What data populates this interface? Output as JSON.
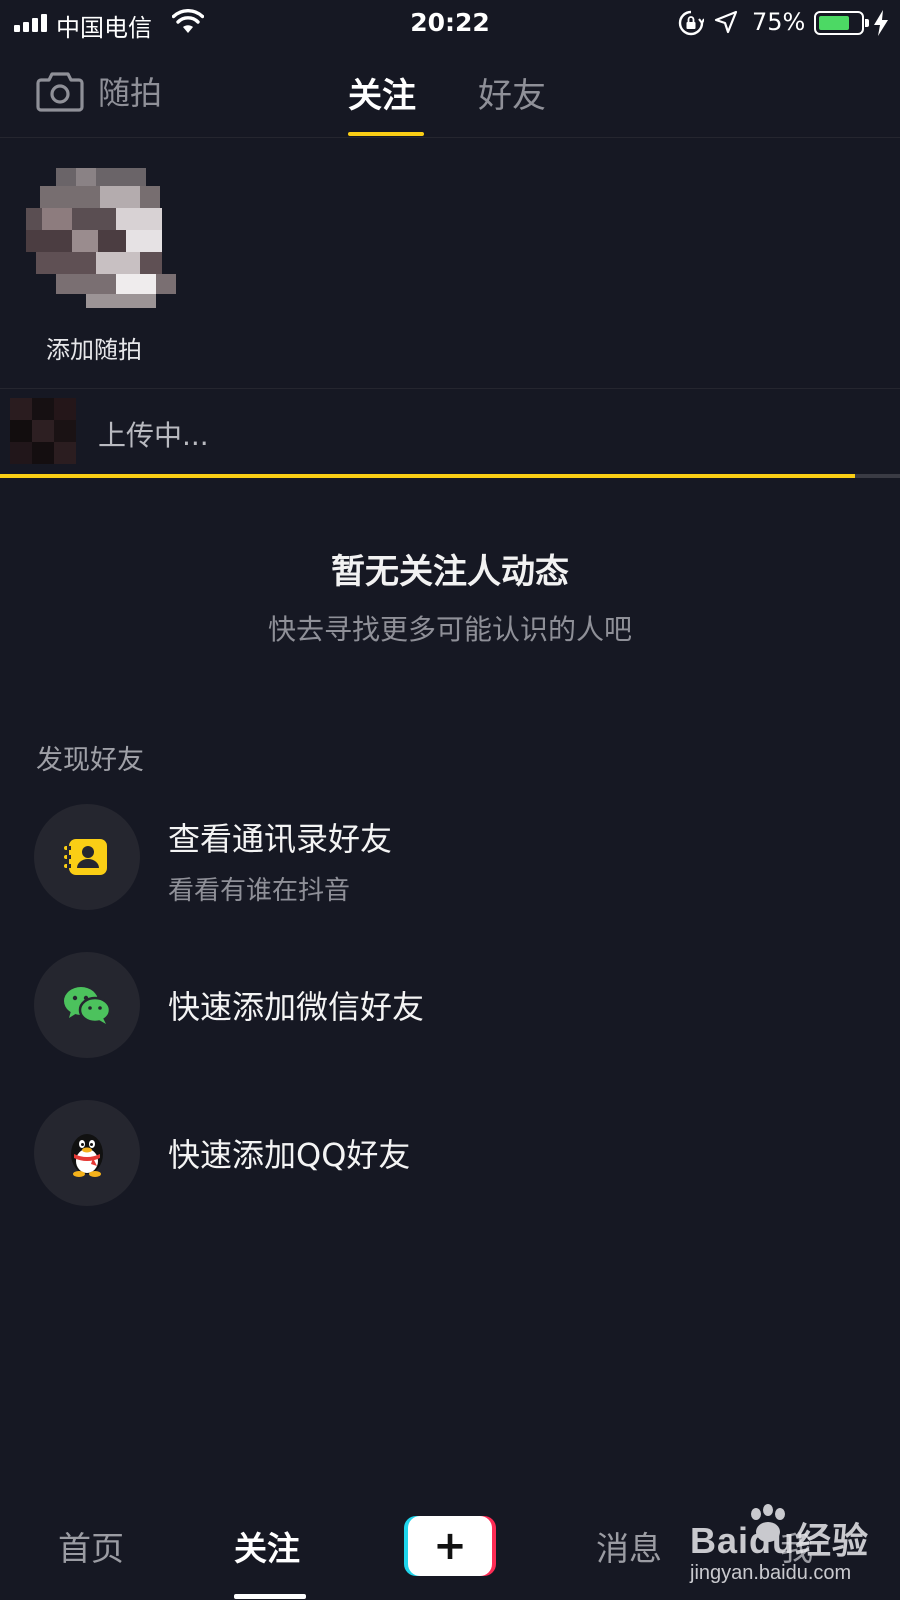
{
  "status_bar": {
    "carrier": "中国电信",
    "time": "20:22",
    "battery_percent": "75%",
    "battery_level": 0.75,
    "icons": [
      "signal-icon",
      "wifi-icon",
      "orientation-lock-icon",
      "location-icon",
      "battery-icon",
      "charging-icon"
    ]
  },
  "top_nav": {
    "camera_label": "随拍",
    "tabs": [
      {
        "label": "关注",
        "active": true
      },
      {
        "label": "好友",
        "active": false
      }
    ],
    "accent_color": "#face15"
  },
  "story": {
    "label": "添加随拍"
  },
  "upload": {
    "label": "上传中...",
    "progress": 0.95
  },
  "empty_state": {
    "title": "暂无关注人动态",
    "subtitle": "快去寻找更多可能认识的人吧"
  },
  "discover": {
    "section_title": "发现好友",
    "items": [
      {
        "title": "查看通讯录好友",
        "subtitle": "看看有谁在抖音",
        "icon": "contacts-icon"
      },
      {
        "title": "快速添加微信好友",
        "icon": "wechat-icon"
      },
      {
        "title": "快速添加QQ好友",
        "icon": "qq-icon"
      }
    ]
  },
  "bottom_nav": {
    "items": [
      {
        "label": "首页",
        "active": false
      },
      {
        "label": "关注",
        "active": true
      },
      {
        "label": "+",
        "icon": "plus-icon"
      },
      {
        "label": "消息",
        "active": false
      },
      {
        "label": "我",
        "active": false
      }
    ]
  },
  "watermark": {
    "brand": "Baidu经验",
    "url": "jingyan.baidu.com"
  },
  "colors": {
    "background": "#161823",
    "accent": "#face15",
    "icon_bg": "#25262f",
    "wechat_green": "#4cc25d",
    "battery_green": "#4cd964"
  }
}
